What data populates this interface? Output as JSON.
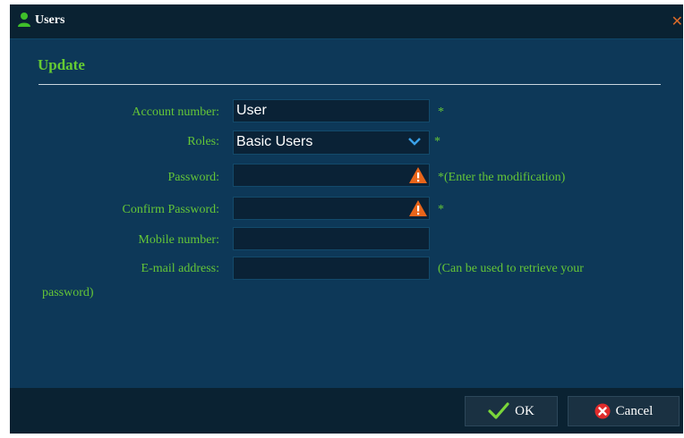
{
  "window": {
    "title": "Users",
    "close_glyph": "✕"
  },
  "section": {
    "title": "Update"
  },
  "form": {
    "account_label": "Account number:",
    "account_value": "User",
    "account_marker": "*",
    "roles_label": "Roles:",
    "roles_value": "Basic Users",
    "roles_marker": "*",
    "password_label": "Password:",
    "password_note": "*(Enter the modification)",
    "confirm_label": "Confirm Password:",
    "confirm_marker": "*",
    "mobile_label": "Mobile number:",
    "email_label": "E-mail address:",
    "email_note": "(Can be used to retrieve your",
    "email_note_wrap": "password)"
  },
  "buttons": {
    "ok_label": "OK",
    "cancel_label": "Cancel"
  },
  "colors": {
    "accent_green": "#66cc33",
    "warning_orange": "#e8651a",
    "cancel_red": "#e02b2b",
    "panel": "#0d3858"
  },
  "icons": {
    "title": "user-icon",
    "roles_dropdown": "chevron-down-icon",
    "field_warning": "warning-icon",
    "ok": "checkmark-icon",
    "cancel": "cancel-icon"
  }
}
